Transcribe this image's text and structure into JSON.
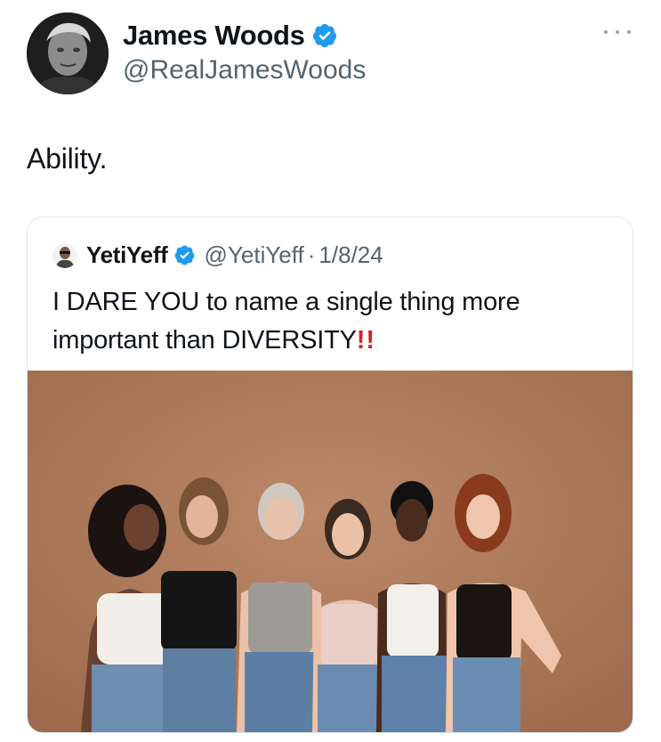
{
  "post": {
    "author": {
      "display_name": "James Woods",
      "handle": "@RealJamesWoods",
      "verified": true
    },
    "text": "Ability.",
    "more_icon": "more-horizontal-icon"
  },
  "quoted_post": {
    "author": {
      "display_name": "YetiYeff",
      "handle": "@YetiYeff",
      "verified": true
    },
    "separator": "·",
    "date": "1/8/24",
    "text": "I DARE YOU to name a single thing more important than DIVERSITY",
    "emphasis": "!!",
    "media": {
      "background_color": "#b07a5a"
    }
  },
  "colors": {
    "verified_blue": "#1d9bf0",
    "secondary_text": "#536471",
    "emphasis_red": "#d91f26"
  }
}
